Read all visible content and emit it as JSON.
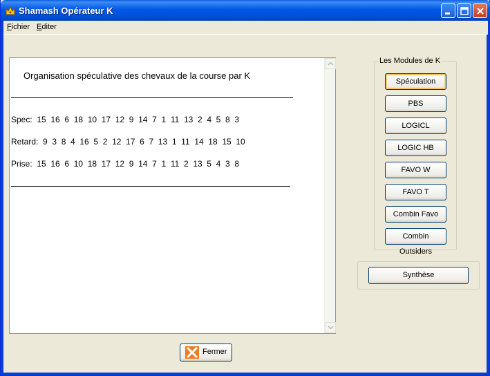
{
  "window": {
    "title": "Shamash Opérateur K"
  },
  "menu": {
    "fichier_first": "F",
    "fichier_rest": "ichier",
    "editer_first": "E",
    "editer_rest": "diter"
  },
  "panel": {
    "heading": "Organisation spéculative des chevaux de la course par K",
    "lines": [
      "Spec:  15  16  6  18  10  17  12  9  14  7  1  11  13  2  4  5  8  3",
      "Retard:  9  3  8  4  16  5  2  12  17  6  7  13  1  11  14  18  15  10",
      "Prise:  15  16  6  10  18  17  12  9  14  7  1  11  2  13  5  4  3  8"
    ]
  },
  "modules": {
    "group_label": "Les Modules de K",
    "buttons": [
      "Spéculation",
      "PBS",
      "LOGICL",
      "LOGIC HB",
      "FAVO W",
      "FAVO T",
      "Combin Favo",
      "Combin Outsiders"
    ]
  },
  "synthese_label": "Synthèse",
  "fermer_label": "Fermer",
  "colors": {
    "titlebar": "#0058e6",
    "close": "#c4411d",
    "fermer_icon": "#f27b1f"
  }
}
